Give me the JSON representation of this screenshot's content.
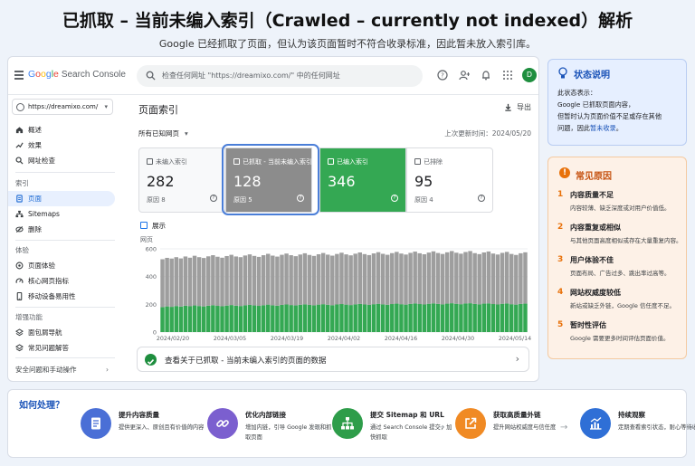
{
  "header": {
    "title": "已抓取 – 当前未编入索引（Crawled – currently not indexed）解析",
    "subtitle": "Google 已经抓取了页面，但认为该页面暂时不符合收录标准，因此暂未放入索引库。"
  },
  "gsc": {
    "logo": {
      "g": "G",
      "o1": "o",
      "o2": "o",
      "g2": "g",
      "l": "l",
      "e": "e",
      "product": "Search Console"
    },
    "search_placeholder": "检查任何网址 \"https://dreamixo.com/\" 中的任何网址",
    "avatar_letter": "D",
    "property": "https://dreamixo.com/",
    "nav": {
      "overview": "概述",
      "performance": "效果",
      "url_inspection": "网址检查",
      "index_section": "索引",
      "pages": "页面",
      "sitemaps": "Sitemaps",
      "removals": "删除",
      "experience_section": "体验",
      "page_experience": "页面体验",
      "core_web_vitals": "核心网页指标",
      "mobile_usability": "移动设备易用性",
      "enhancements_section": "增强功能",
      "breadcrumbs": "面包屑导航",
      "faq": "常见问题解答",
      "security": "安全问题和手动操作"
    },
    "page_title": "页面索引",
    "export_label": "导出",
    "filter_label": "所有已知网页",
    "last_updated": "上次更新时间：2024/05/20",
    "cards": [
      {
        "label": "未编入索引",
        "value": "282",
        "reason": "原因 8"
      },
      {
        "label": "已抓取 - 当前未编入索引",
        "value": "128",
        "reason": "原因 5"
      },
      {
        "label": "已编入索引",
        "value": "346",
        "reason": ""
      },
      {
        "label": "已排除",
        "value": "95",
        "reason": "原因 4"
      }
    ],
    "show_label": "展示",
    "result_row": "查看关于已抓取 - 当前未编入索引的页面的数据"
  },
  "chart_data": {
    "type": "bar",
    "ylabel": "网页",
    "ylim": [
      0,
      600
    ],
    "yticks": [
      "600",
      "400",
      "200",
      "0"
    ],
    "xtick_labels": [
      "2024/02/20",
      "2024/03/05",
      "2024/03/19",
      "2024/04/02",
      "2024/04/16",
      "2024/04/30",
      "2024/05/14"
    ],
    "series": [
      {
        "name": "已编入索引",
        "color": "#34a853",
        "values": [
          180,
          185,
          182,
          188,
          184,
          190,
          186,
          192,
          188,
          185,
          190,
          194,
          189,
          186,
          191,
          195,
          190,
          188,
          193,
          196,
          192,
          189,
          194,
          198,
          193,
          190,
          196,
          199,
          195,
          192,
          197,
          200,
          196,
          193,
          198,
          201,
          197,
          194,
          199,
          202,
          198,
          195,
          200,
          203,
          199,
          196,
          201,
          204,
          200,
          197,
          202,
          205,
          201,
          198,
          203,
          206,
          202,
          199,
          204,
          207,
          203,
          200,
          205,
          208,
          204,
          201,
          206,
          208,
          203,
          200,
          205,
          207,
          202,
          199,
          204,
          206,
          201,
          198,
          203,
          205
        ]
      },
      {
        "name": "未编入索引",
        "color": "#9e9e9e",
        "values": [
          345,
          350,
          348,
          352,
          347,
          355,
          350,
          358,
          352,
          349,
          356,
          360,
          354,
          350,
          357,
          362,
          355,
          352,
          359,
          364,
          357,
          353,
          360,
          366,
          358,
          354,
          361,
          367,
          359,
          355,
          362,
          368,
          360,
          356,
          363,
          369,
          361,
          357,
          364,
          370,
          362,
          358,
          365,
          371,
          363,
          359,
          366,
          372,
          364,
          360,
          367,
          373,
          365,
          361,
          368,
          374,
          366,
          362,
          369,
          375,
          367,
          363,
          370,
          376,
          368,
          364,
          371,
          376,
          366,
          362,
          369,
          374,
          364,
          360,
          367,
          372,
          362,
          358,
          365,
          370
        ]
      }
    ]
  },
  "status_panel": {
    "title": "状态说明",
    "line1": "此状态表示：",
    "line2": "Google 已抓取页面内容，",
    "line3": "但暂时认为页面价值不足或存在其他",
    "line4_a": "问题，因此",
    "line4_b": "暂未收录",
    "line4_c": "。"
  },
  "reasons_panel": {
    "title": "常见原因",
    "items": [
      {
        "n": "1",
        "h": "内容质量不足",
        "d": "内容较薄、缺乏深度或对用户价值低。"
      },
      {
        "n": "2",
        "h": "内容重复或相似",
        "d": "与其他页面高度相似或存在大量重复内容。"
      },
      {
        "n": "3",
        "h": "用户体验不佳",
        "d": "页面布局、广告过多、跳出率过高等。"
      },
      {
        "n": "4",
        "h": "网站权威度较低",
        "d": "新站或缺乏外链，Google 信任度不足。"
      },
      {
        "n": "5",
        "h": "暂时性评估",
        "d": "Google 需要更多时间评估页面价值。"
      }
    ]
  },
  "howto": {
    "title": "如何处理？",
    "steps": [
      {
        "title": "提升内容质量",
        "desc": "提供更深入、原创且有价值的内容",
        "color": "#4a6fd6",
        "icon": "document-icon"
      },
      {
        "title": "优化内部链接",
        "desc": "增加内链，引导 Google 发现和抓取页面",
        "color": "#7b5fcf",
        "icon": "link-icon"
      },
      {
        "title": "提交 Sitemap 和 URL",
        "desc": "通过 Search Console 提交，加快抓取",
        "color": "#2e9d4a",
        "icon": "sitemap-icon"
      },
      {
        "title": "获取高质量外链",
        "desc": "提升网站权威度与信任度",
        "color": "#f08a24",
        "icon": "external-link-icon"
      },
      {
        "title": "持续观察",
        "desc": "定期查看索引状态，耐心等待收录",
        "color": "#2f6fd6",
        "icon": "chart-icon"
      }
    ]
  }
}
